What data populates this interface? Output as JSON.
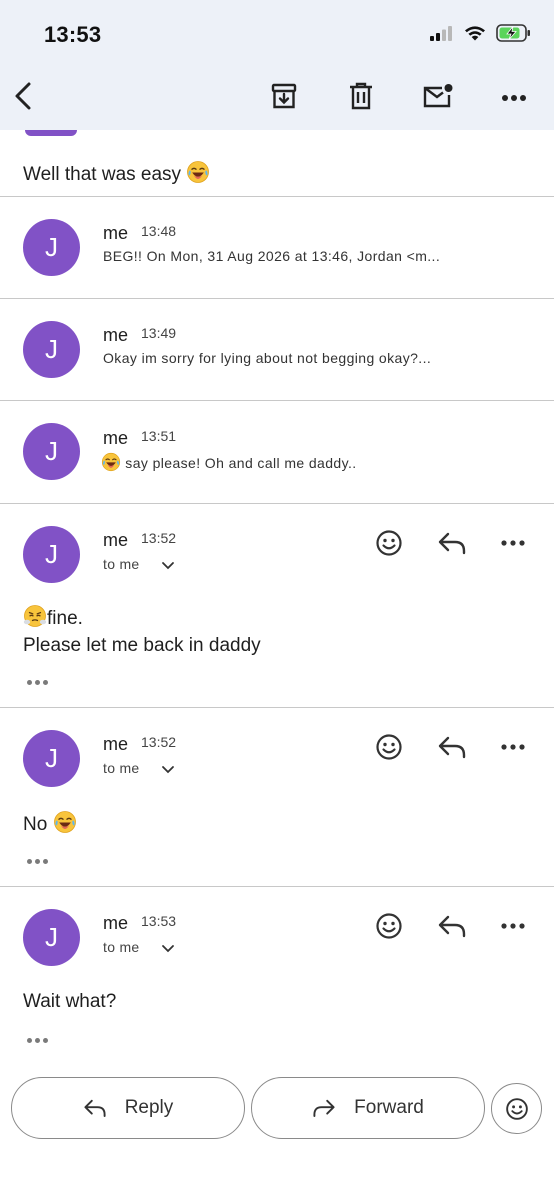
{
  "status_bar": {
    "time": "13:53",
    "icons": [
      "signal-icon",
      "wifi-icon",
      "battery-charging-icon"
    ]
  },
  "toolbar": {
    "icons": [
      "back-icon",
      "archive-icon",
      "delete-icon",
      "mark-unread-icon",
      "more-icon"
    ]
  },
  "thread": {
    "partial_message": {
      "text": "Well that was easy",
      "emoji": "😂"
    },
    "collapsed": [
      {
        "avatar": "J",
        "sender": "me",
        "time": "13:48",
        "snippet": "BEG!! On Mon, 31 Aug 2026 at 13:46, Jordan <m..."
      },
      {
        "avatar": "J",
        "sender": "me",
        "time": "13:49",
        "snippet": "Okay im sorry for lying about not begging okay?..."
      },
      {
        "avatar": "J",
        "sender": "me",
        "time": "13:51",
        "snippet": "say please! Oh and call me daddy..",
        "snippet_emoji": "😂"
      }
    ],
    "expanded": [
      {
        "avatar": "J",
        "sender": "me",
        "time": "13:52",
        "to": "to me",
        "emoji": "😤",
        "line1": "fine.",
        "line2": "Please let me back in daddy"
      },
      {
        "avatar": "J",
        "sender": "me",
        "time": "13:52",
        "to": "to me",
        "line1": "No",
        "emoji": "😂"
      },
      {
        "avatar": "J",
        "sender": "me",
        "time": "13:53",
        "to": "to me",
        "line1": "Wait what?"
      }
    ]
  },
  "actions": {
    "reply_label": "Reply",
    "forward_label": "Forward"
  },
  "colors": {
    "avatar": "#8152c6",
    "header_bg": "#edf1f8",
    "battery_fill": "#5bd45b"
  }
}
